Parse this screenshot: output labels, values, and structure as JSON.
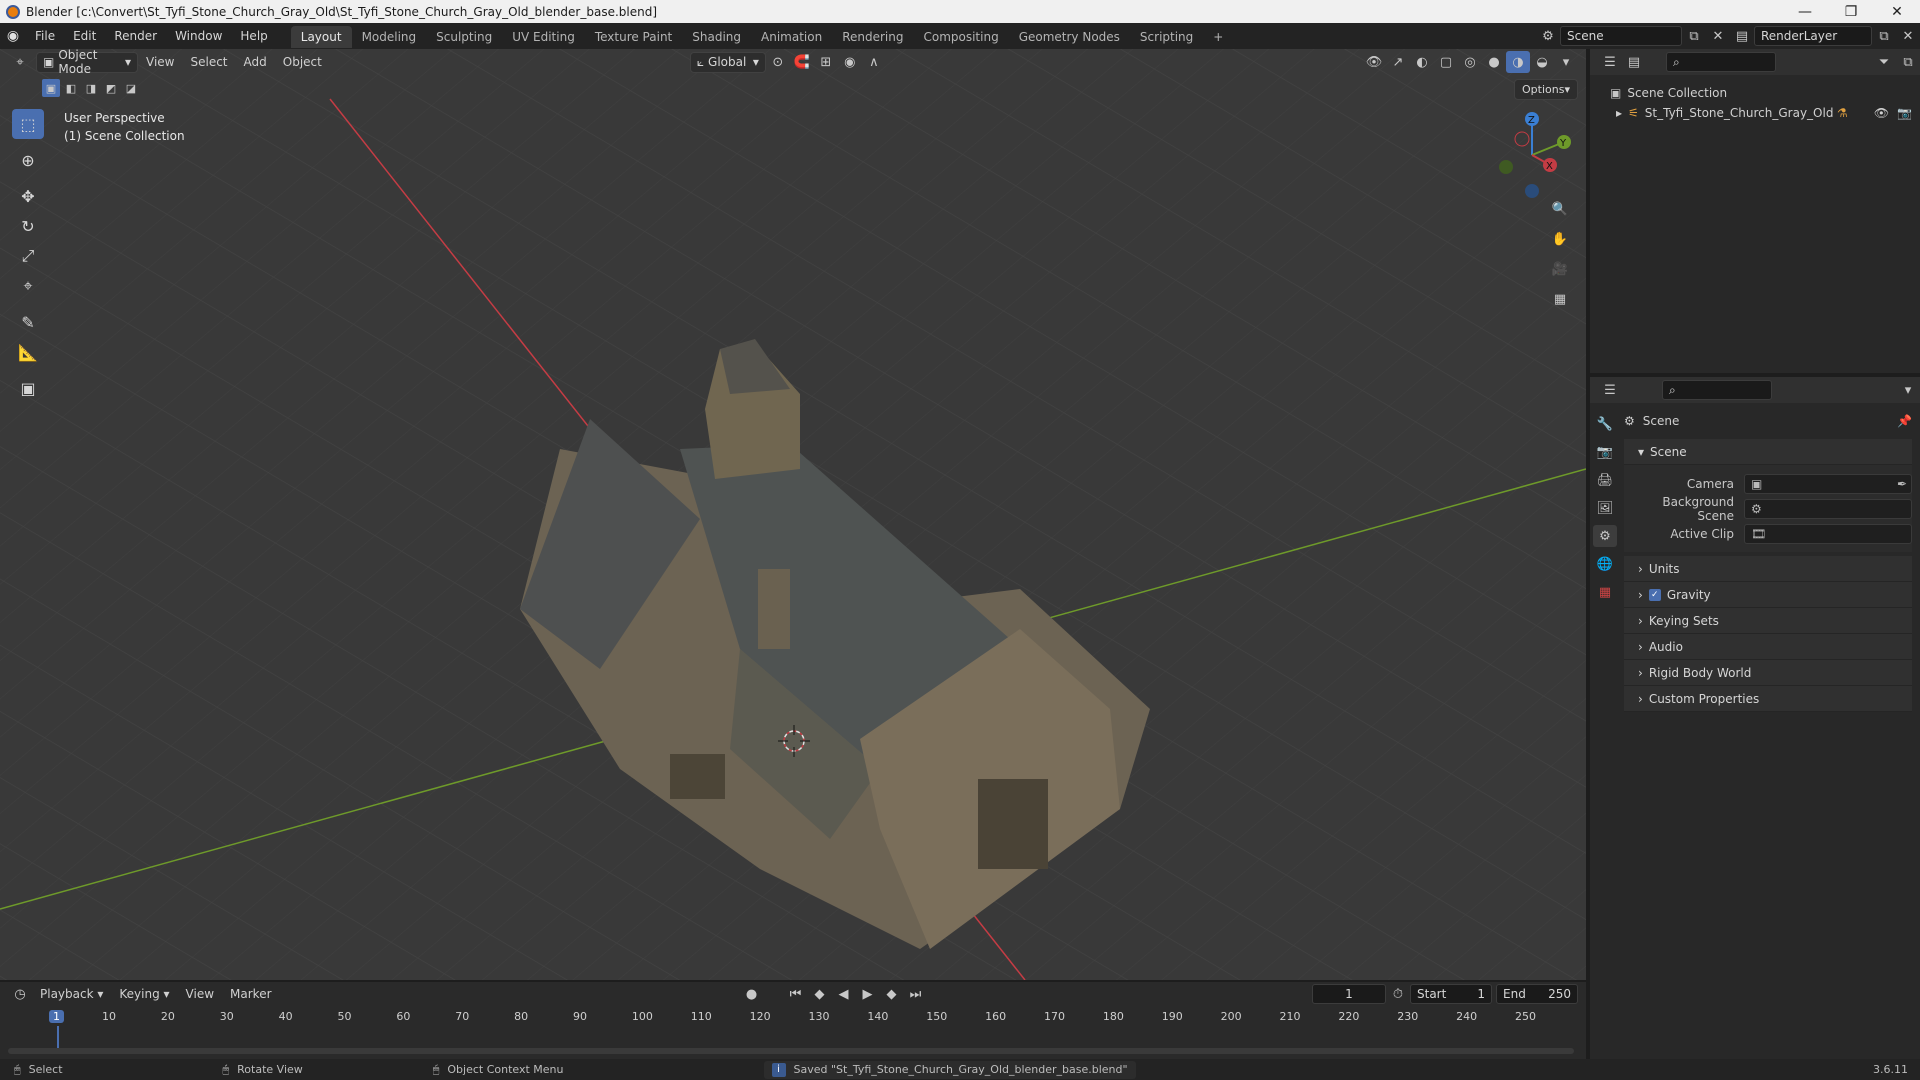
{
  "window": {
    "title": "Blender [c:\\Convert\\St_Tyfi_Stone_Church_Gray_Old\\St_Tyfi_Stone_Church_Gray_Old_blender_base.blend]",
    "minimize": "—",
    "maximize": "❐",
    "close": "✕"
  },
  "menus": [
    "File",
    "Edit",
    "Render",
    "Window",
    "Help"
  ],
  "workspaces": [
    "Layout",
    "Modeling",
    "Sculpting",
    "UV Editing",
    "Texture Paint",
    "Shading",
    "Animation",
    "Rendering",
    "Compositing",
    "Geometry Nodes",
    "Scripting"
  ],
  "workspace_add": "+",
  "scene_selector": "Scene",
  "view_layer_selector": "RenderLayer",
  "viewport": {
    "mode": "Object Mode",
    "menus": [
      "View",
      "Select",
      "Add",
      "Object"
    ],
    "orientation": "Global",
    "options_label": "Options",
    "overlay_line1": "User Perspective",
    "overlay_line2": "(1) Scene Collection",
    "gizmo": {
      "z": "Z",
      "y": "Y",
      "x": "X"
    },
    "colors": {
      "x_axis": "#c43c44",
      "y_axis": "#6e9a2a",
      "z_axis": "#3a7fd4",
      "active_tool": "#4a6fb0"
    }
  },
  "outliner": {
    "root": "Scene Collection",
    "items": [
      {
        "name": "St_Tyfi_Stone_Church_Gray_Old"
      }
    ]
  },
  "properties": {
    "header": "Scene",
    "section_scene": "Scene",
    "fields": [
      {
        "label": "Camera",
        "value": ""
      },
      {
        "label": "Background Scene",
        "value": ""
      },
      {
        "label": "Active Clip",
        "value": ""
      }
    ],
    "panels": [
      {
        "label": "Units",
        "checkbox": false
      },
      {
        "label": "Gravity",
        "checkbox": true
      },
      {
        "label": "Keying Sets",
        "checkbox": false
      },
      {
        "label": "Audio",
        "checkbox": false
      },
      {
        "label": "Rigid Body World",
        "checkbox": false
      },
      {
        "label": "Custom Properties",
        "checkbox": false
      }
    ]
  },
  "timeline": {
    "menus": [
      "Playback",
      "Keying",
      "View",
      "Marker"
    ],
    "current_frame": "1",
    "start_label": "Start",
    "start": "1",
    "end_label": "End",
    "end": "250",
    "ticks": [
      "1",
      "10",
      "20",
      "30",
      "40",
      "50",
      "60",
      "70",
      "80",
      "90",
      "100",
      "110",
      "120",
      "130",
      "140",
      "150",
      "160",
      "170",
      "180",
      "190",
      "200",
      "210",
      "220",
      "230",
      "240",
      "250"
    ]
  },
  "status": {
    "select": "Select",
    "rotate": "Rotate View",
    "context": "Object Context Menu",
    "message": "Saved \"St_Tyfi_Stone_Church_Gray_Old_blender_base.blend\"",
    "version": "3.6.11"
  }
}
